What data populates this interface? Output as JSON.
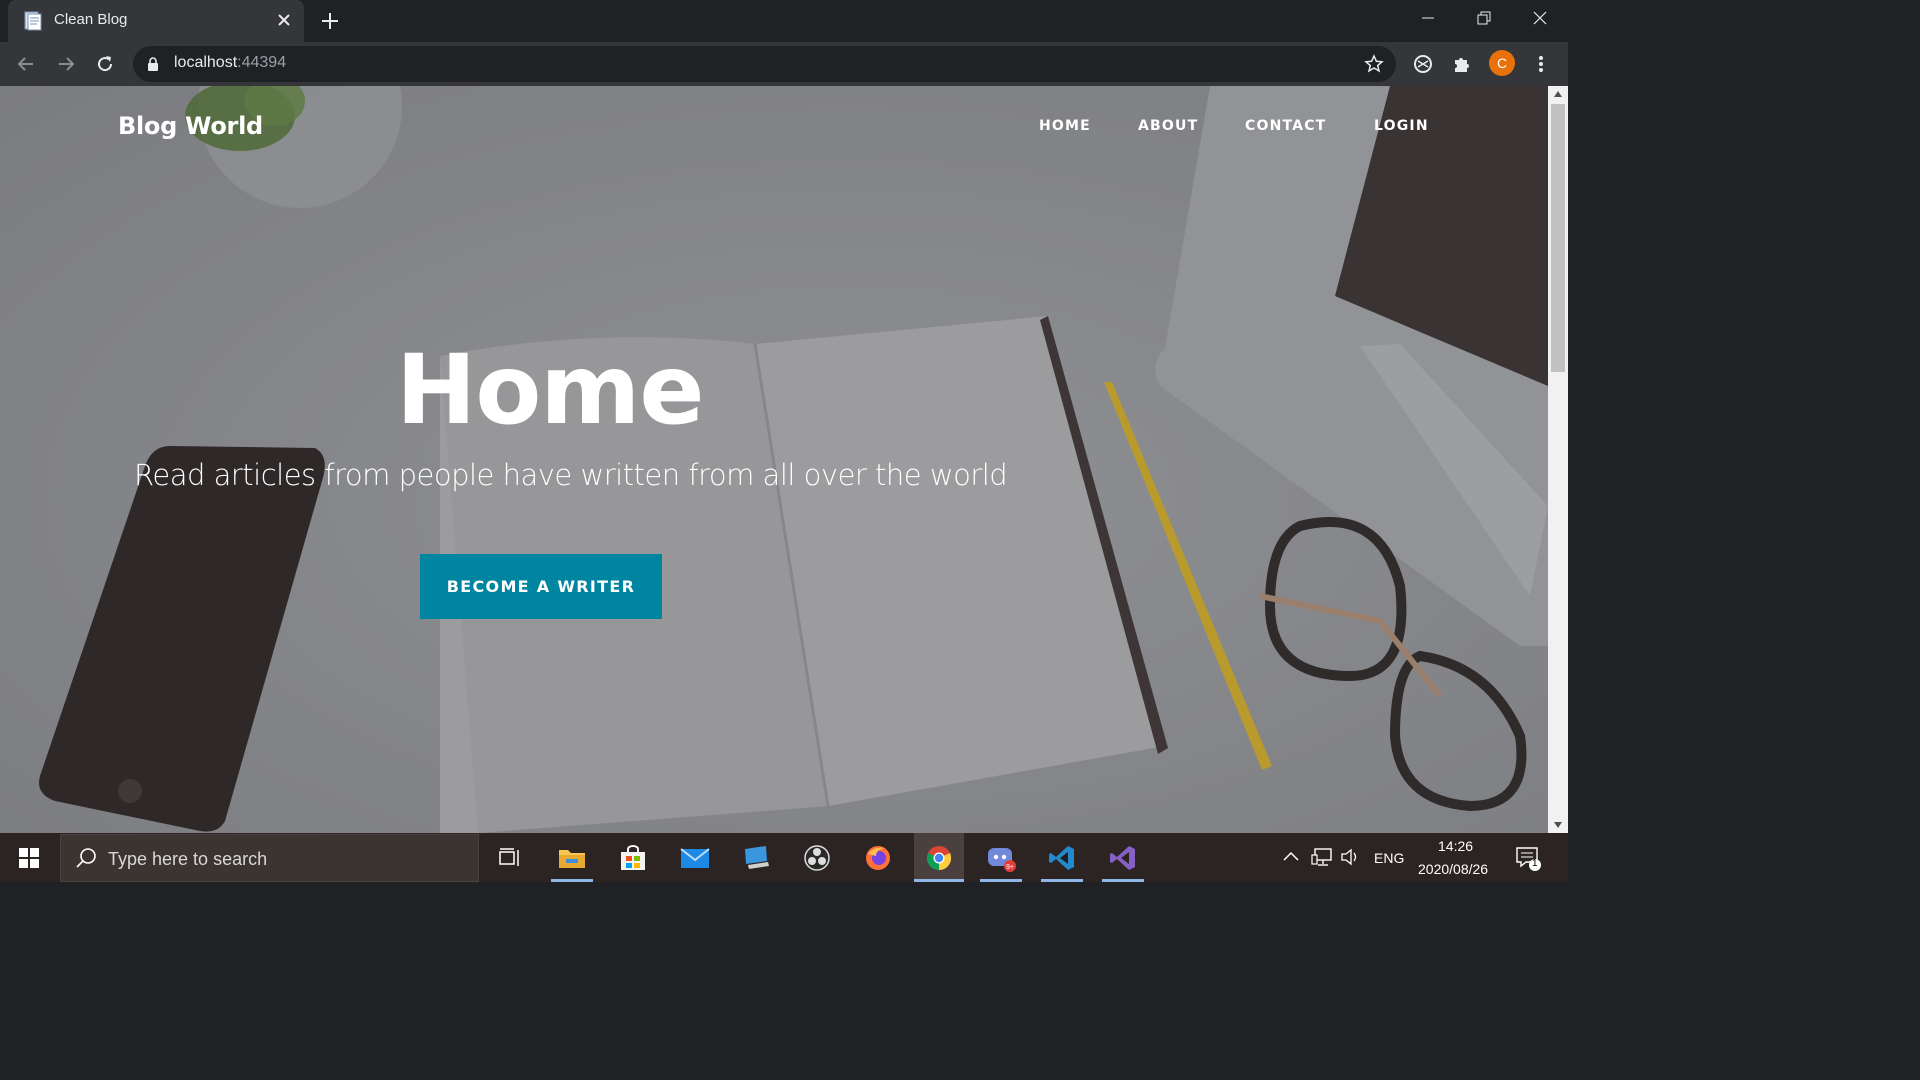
{
  "browser": {
    "tab_title": "Clean Blog",
    "url_host": "localhost",
    "url_port": ":44394",
    "profile_initial": "C"
  },
  "site": {
    "brand": "Blog World",
    "nav": [
      "HOME",
      "ABOUT",
      "CONTACT",
      "LOGIN"
    ],
    "hero_title": "Home",
    "hero_subtitle": "Read articles from people have written from all over the world",
    "cta_label": "BECOME A WRITER",
    "cta_color": "#0085a1"
  },
  "taskbar": {
    "search_placeholder": "Type here to search",
    "apps": [
      "task-view",
      "file-explorer",
      "microsoft-store",
      "mail",
      "remote-desktop",
      "obs-studio",
      "firefox",
      "chrome",
      "discord",
      "vs-code",
      "visual-studio"
    ],
    "discord_badge": "9+",
    "language": "ENG",
    "time": "14:26",
    "date": "2020/08/26",
    "notification_count": "1"
  }
}
